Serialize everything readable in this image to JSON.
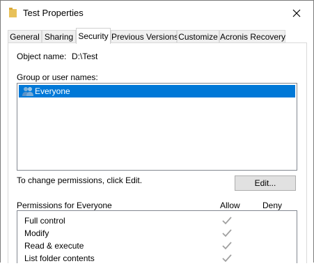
{
  "window": {
    "title": "Test Properties",
    "close_glyph": "✕"
  },
  "tabs": [
    {
      "label": "General"
    },
    {
      "label": "Sharing"
    },
    {
      "label": "Security"
    },
    {
      "label": "Previous Versions"
    },
    {
      "label": "Customize"
    },
    {
      "label": "Acronis Recovery"
    }
  ],
  "security": {
    "object_name_label": "Object name:",
    "object_name_value": "D:\\Test",
    "group_label": "Group or user names:",
    "users": [
      {
        "name": "Everyone",
        "icon": "users-icon",
        "selected": true
      }
    ],
    "change_hint": "To change permissions, click Edit.",
    "edit_button": "Edit...",
    "permissions_header": "Permissions for Everyone",
    "allow_header": "Allow",
    "deny_header": "Deny",
    "permissions": [
      {
        "name": "Full control",
        "allow": true
      },
      {
        "name": "Modify",
        "allow": true
      },
      {
        "name": "Read & execute",
        "allow": true
      },
      {
        "name": "List folder contents",
        "allow": true
      }
    ]
  },
  "colors": {
    "selection": "#0078d7",
    "check_disabled": "#a0a0a0"
  }
}
